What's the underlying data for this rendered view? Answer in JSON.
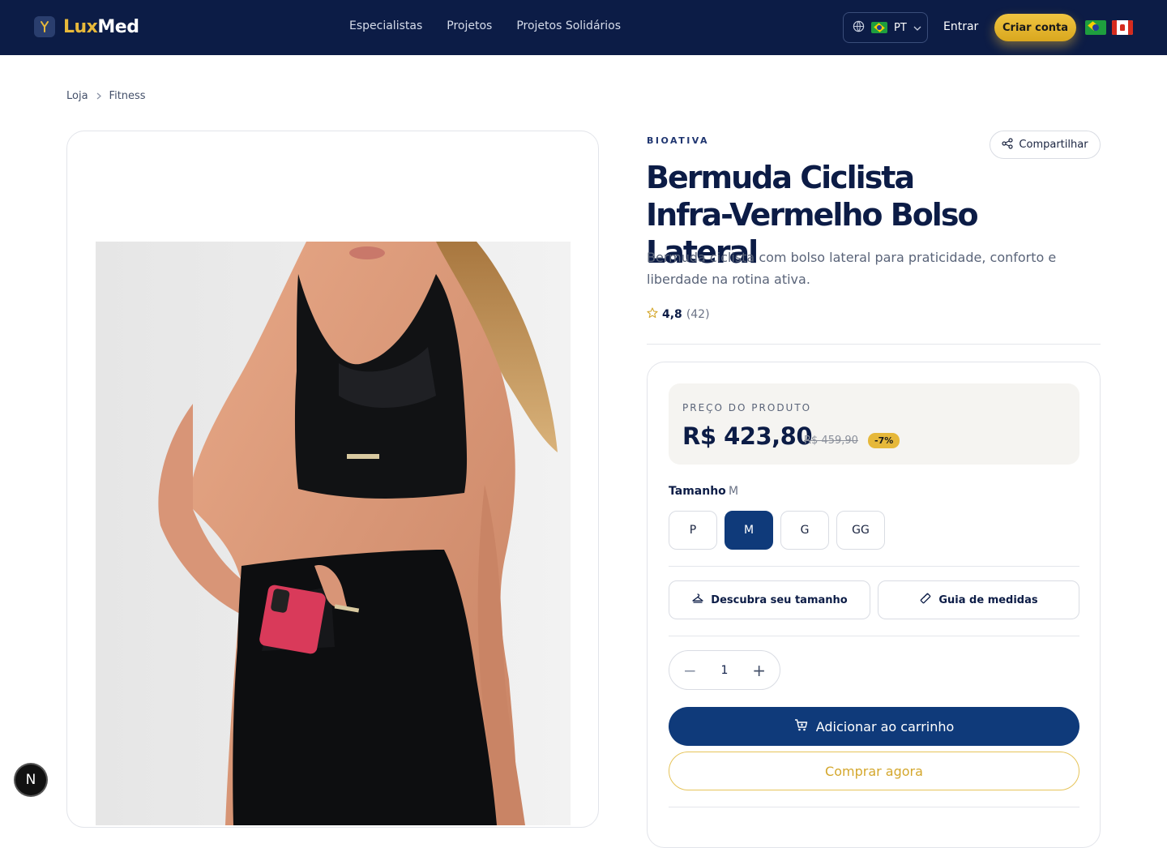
{
  "header": {
    "logo_part1": "Lux",
    "logo_part2": "Med",
    "nav": [
      "Especialistas",
      "Projetos",
      "Projetos Solidários"
    ],
    "language": "PT",
    "login": "Entrar",
    "signup": "Criar conta"
  },
  "breadcrumb": [
    "Loja",
    "Fitness"
  ],
  "product": {
    "brand": "BIOATIVA",
    "share": "Compartilhar",
    "title": "Bermuda Ciclista Infra-Vermelho Bolso Lateral",
    "description": "Bermuda ciclista com bolso lateral para praticidade, conforto e liberdade na rotina ativa.",
    "rating": "4,8",
    "reviews": "(42)"
  },
  "purchase": {
    "price_label": "PREÇO DO PRODUTO",
    "price": "R$ 423,80",
    "old_price": "R$ 459,90",
    "discount": "-7%",
    "size_label": "Tamanho",
    "selected_size": "M",
    "sizes": [
      "P",
      "M",
      "G",
      "GG"
    ],
    "find_size": "Descubra seu tamanho",
    "size_guide": "Guia de medidas",
    "quantity": "1",
    "add_to_cart": "Adicionar ao carrinho",
    "buy_now": "Comprar agora"
  },
  "dev_badge": "N",
  "colors": {
    "navy": "#0c1c46",
    "primary": "#0f3a7a",
    "gold": "#e8b93a"
  }
}
